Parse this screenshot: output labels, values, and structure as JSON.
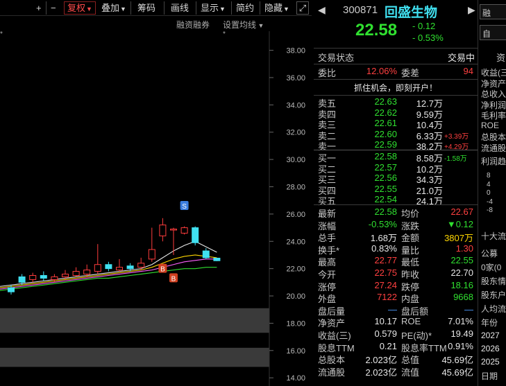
{
  "toolbar": {
    "plus": "+",
    "minus": "−",
    "fuquan": "复权",
    "diejia": "叠加",
    "chouma": "筹码",
    "huaxian": "画线",
    "xianshi": "显示",
    "jianyue": "简约",
    "yincang": "隐藏",
    "expand_icon": "expand-icon"
  },
  "subbar": {
    "rzrq": "融资融券",
    "settings": "设置均线"
  },
  "stock": {
    "code": "300871",
    "name": "回盛生物",
    "price": "22.58",
    "change": "- 0.12",
    "change_pct": "- 0.53%"
  },
  "status": {
    "label": "交易状态",
    "value": "交易中"
  },
  "weibi": {
    "label": "委比",
    "value": "12.06%",
    "diff_label": "委差",
    "diff_value": "94"
  },
  "banner": "抓住机会，即刻开户！",
  "asks": [
    {
      "label": "卖五",
      "price": "22.63",
      "vol": "12.7万",
      "delta": ""
    },
    {
      "label": "卖四",
      "price": "22.62",
      "vol": "9.59万",
      "delta": ""
    },
    {
      "label": "卖三",
      "price": "22.61",
      "vol": "10.4万",
      "delta": ""
    },
    {
      "label": "卖二",
      "price": "22.60",
      "vol": "6.33万",
      "delta": "+3.39万"
    },
    {
      "label": "卖一",
      "price": "22.59",
      "vol": "38.2万",
      "delta": "+4.29万"
    }
  ],
  "bids": [
    {
      "label": "买一",
      "price": "22.58",
      "vol": "8.58万",
      "delta": "-1.58万"
    },
    {
      "label": "买二",
      "price": "22.57",
      "vol": "10.2万",
      "delta": ""
    },
    {
      "label": "买三",
      "price": "22.56",
      "vol": "34.3万",
      "delta": ""
    },
    {
      "label": "买四",
      "price": "22.55",
      "vol": "21.0万",
      "delta": ""
    },
    {
      "label": "买五",
      "price": "22.54",
      "vol": "24.1万",
      "delta": ""
    }
  ],
  "stats": [
    {
      "l1": "最新",
      "v1": "22.58",
      "c1": "green",
      "l2": "均价",
      "v2": "22.67",
      "c2": "red"
    },
    {
      "l1": "涨幅",
      "v1": "-0.53%",
      "c1": "green",
      "l2": "涨跌",
      "v2": "▼0.12",
      "c2": "green"
    },
    {
      "l1": "总手",
      "v1": "1.68万",
      "c1": "white",
      "l2": "金额",
      "v2": "3807万",
      "c2": "yellow"
    },
    {
      "l1": "换手*",
      "v1": "0.83%",
      "c1": "white",
      "l2": "量比",
      "v2": "1.30",
      "c2": "red"
    },
    {
      "l1": "最高",
      "v1": "22.77",
      "c1": "red",
      "l2": "最低",
      "v2": "22.55",
      "c2": "green"
    },
    {
      "l1": "今开",
      "v1": "22.75",
      "c1": "red",
      "l2": "昨收",
      "v2": "22.70",
      "c2": "white"
    },
    {
      "l1": "涨停",
      "v1": "27.24",
      "c1": "red",
      "l2": "跌停",
      "v2": "18.16",
      "c2": "green"
    },
    {
      "l1": "外盘",
      "v1": "7122",
      "c1": "red",
      "l2": "内盘",
      "v2": "9668",
      "c2": "green"
    },
    {
      "l1": "盘后量",
      "v1": "—",
      "c1": "blue",
      "l2": "盘后额",
      "v2": "—",
      "c2": "blue"
    },
    {
      "l1": "净资产",
      "v1": "10.17",
      "c1": "white",
      "l2": "ROE",
      "v2": "7.01%",
      "c2": "white"
    },
    {
      "l1": "收益(三)",
      "v1": "0.579",
      "c1": "white",
      "l2": "PE(动)*",
      "v2": "19.49",
      "c2": "white"
    },
    {
      "l1": "股息TTM",
      "v1": "0.21",
      "c1": "white",
      "l2": "股息率TTM",
      "v2": "0.91%",
      "c2": "white"
    },
    {
      "l1": "总股本",
      "v1": "2.023亿",
      "c1": "white",
      "l2": "总值",
      "v2": "45.69亿",
      "c2": "white"
    },
    {
      "l1": "流通股",
      "v1": "2.023亿",
      "c1": "white",
      "l2": "流值",
      "v2": "45.69亿",
      "c2": "white"
    }
  ],
  "far": {
    "top_btn1": "融",
    "top_btn2": "自",
    "zi": "资",
    "items": [
      "收益(三",
      "净资产",
      "总收入",
      "净利润",
      "毛利率",
      "ROE",
      "总股本",
      "流通股"
    ],
    "lirun": "利润趋",
    "axis": [
      "8",
      "4",
      "0",
      "-4",
      "-8"
    ],
    "shida": "十大流",
    "gongmu": "公募",
    "jia": "0家(0",
    "gudong1": "股东情",
    "gudong2": "股东户",
    "renjun": "人均流",
    "nianfen": "年份",
    "years": [
      "2027",
      "2026",
      "2025"
    ],
    "riqi": "日期"
  },
  "chart_data": {
    "type": "candlestick",
    "y_ticks": [
      "38.00",
      "36.00",
      "34.00",
      "32.00",
      "30.00",
      "28.00",
      "26.00",
      "24.00",
      "22.00",
      "20.00",
      "18.00",
      "16.00",
      "14.00"
    ],
    "ylim": [
      13.4,
      39.4
    ],
    "x_count": 26,
    "candles": [
      {
        "i": 0,
        "o": 20.6,
        "c": 20.3,
        "h": 20.8,
        "l": 20.1
      },
      {
        "i": 1,
        "o": 21.4,
        "c": 21.0,
        "h": 21.6,
        "l": 20.8
      },
      {
        "i": 2,
        "o": 21.2,
        "c": 21.5,
        "h": 21.7,
        "l": 21.0
      },
      {
        "i": 3,
        "o": 21.5,
        "c": 21.3,
        "h": 21.8,
        "l": 21.1
      },
      {
        "i": 4,
        "o": 21.2,
        "c": 21.4,
        "h": 21.6,
        "l": 21.0
      },
      {
        "i": 5,
        "o": 21.4,
        "c": 21.6,
        "h": 21.9,
        "l": 21.2
      },
      {
        "i": 6,
        "o": 21.5,
        "c": 21.8,
        "h": 22.1,
        "l": 21.4
      },
      {
        "i": 7,
        "o": 21.6,
        "c": 21.9,
        "h": 22.3,
        "l": 21.4
      },
      {
        "i": 8,
        "o": 21.8,
        "c": 22.3,
        "h": 23.8,
        "l": 21.6
      },
      {
        "i": 9,
        "o": 22.3,
        "c": 22.0,
        "h": 22.5,
        "l": 21.8
      },
      {
        "i": 10,
        "o": 21.9,
        "c": 22.1,
        "h": 22.7,
        "l": 21.8
      },
      {
        "i": 11,
        "o": 22.2,
        "c": 22.0,
        "h": 22.4,
        "l": 21.8
      },
      {
        "i": 12,
        "o": 22.1,
        "c": 22.4,
        "h": 22.8,
        "l": 21.9
      },
      {
        "i": 13,
        "o": 22.7,
        "c": 23.4,
        "h": 25.0,
        "l": 22.5
      },
      {
        "i": 14,
        "o": 24.4,
        "c": 25.2,
        "h": 25.7,
        "l": 24.0
      },
      {
        "i": 15,
        "o": 24.9,
        "c": 24.9,
        "h": 25.0,
        "l": 23.0
      },
      {
        "i": 16,
        "o": 24.6,
        "c": 25.0,
        "h": 25.1,
        "l": 24.5
      },
      {
        "i": 17,
        "o": 25.0,
        "c": 23.9,
        "h": 25.1,
        "l": 23.7
      },
      {
        "i": 18,
        "o": 23.3,
        "c": 22.8,
        "h": 23.5,
        "l": 22.7
      },
      {
        "i": 19,
        "o": 22.77,
        "c": 22.58,
        "h": 22.77,
        "l": 22.55
      }
    ],
    "ma": [
      {
        "name": "ma_white",
        "color": "#e8e8e8",
        "values": [
          20.8,
          20.9,
          21.0,
          21.1,
          21.2,
          21.3,
          21.4,
          21.5,
          21.6,
          21.7,
          21.8,
          21.9,
          22.0,
          22.3,
          22.8,
          23.3,
          23.7,
          24.0,
          23.6,
          23.2
        ]
      },
      {
        "name": "ma_yellow",
        "color": "#ffd700",
        "values": [
          20.7,
          20.8,
          20.9,
          21.0,
          21.1,
          21.2,
          21.3,
          21.4,
          21.5,
          21.6,
          21.7,
          21.8,
          21.9,
          22.1,
          22.4,
          22.7,
          22.9,
          23.0,
          22.9,
          22.8
        ]
      },
      {
        "name": "ma_pink",
        "color": "#ff60ff",
        "values": [
          20.6,
          20.7,
          20.8,
          20.9,
          21.0,
          21.1,
          21.2,
          21.3,
          21.4,
          21.5,
          21.6,
          21.7,
          21.8,
          21.9,
          22.1,
          22.3,
          22.5,
          22.6,
          22.7,
          22.7
        ]
      },
      {
        "name": "ma_green",
        "color": "#30e030",
        "values": [
          20.5,
          20.6,
          20.7,
          20.8,
          20.9,
          21.0,
          21.1,
          21.2,
          21.3,
          21.3,
          21.4,
          21.5,
          21.6,
          21.7,
          21.8,
          21.9,
          22.0,
          22.0,
          22.1,
          22.1
        ]
      }
    ],
    "markers": [
      {
        "text": "S",
        "i": 16,
        "y": 26.6,
        "color": "#3a7de0"
      },
      {
        "text": "B",
        "i": 14,
        "y": 22.0,
        "color": "#d04020"
      },
      {
        "text": "B",
        "i": 15,
        "y": 21.3,
        "color": "#d04020"
      }
    ]
  }
}
